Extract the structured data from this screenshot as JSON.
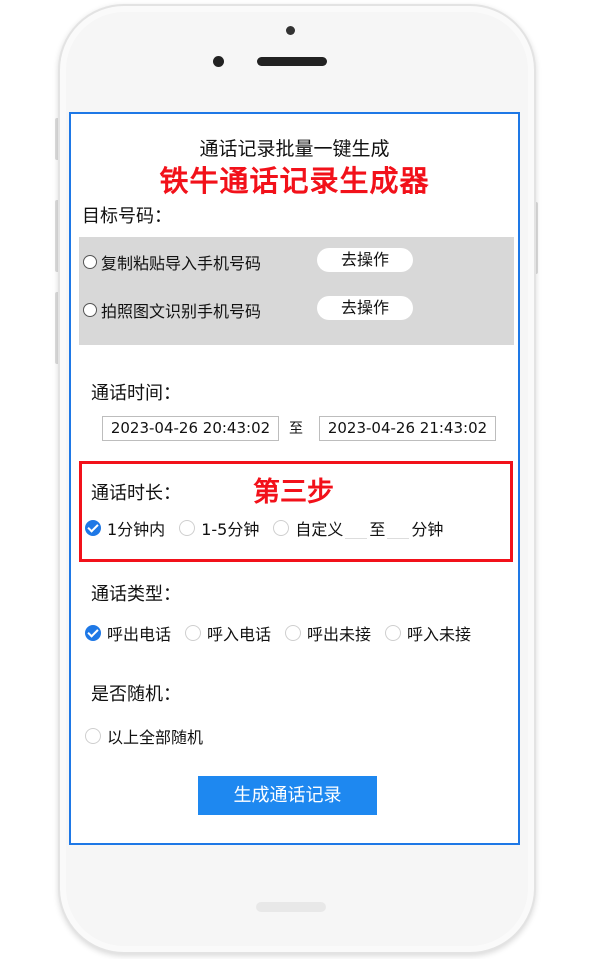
{
  "header": {
    "subtitle": "通话记录批量一键生成",
    "title": "铁牛通话记录生成器"
  },
  "target_numbers": {
    "label": "目标号码：",
    "options": [
      {
        "label": "复制粘贴导入手机号码",
        "button": "去操作"
      },
      {
        "label": "拍照图文识别手机号码",
        "button": "去操作"
      }
    ]
  },
  "call_time": {
    "label": "通话时间：",
    "start": "2023-04-26 20:43:02",
    "separator": "至",
    "end": "2023-04-26 21:43:02"
  },
  "call_duration": {
    "label": "通话时长：",
    "step_annotation": "第三步",
    "options": [
      "1分钟内",
      "1-5分钟",
      "自定义"
    ],
    "selected": "1分钟内",
    "custom_separator": "至",
    "custom_unit": "分钟"
  },
  "call_type": {
    "label": "通话类型：",
    "options": [
      "呼出电话",
      "呼入电话",
      "呼出未接",
      "呼入未接"
    ],
    "selected": "呼出电话"
  },
  "random": {
    "label": "是否随机：",
    "option": "以上全部随机"
  },
  "generate_button": "生成通话记录",
  "colors": {
    "accent": "#1e78e6",
    "button": "#1e88f0",
    "annotation_red": "#f2111a"
  }
}
